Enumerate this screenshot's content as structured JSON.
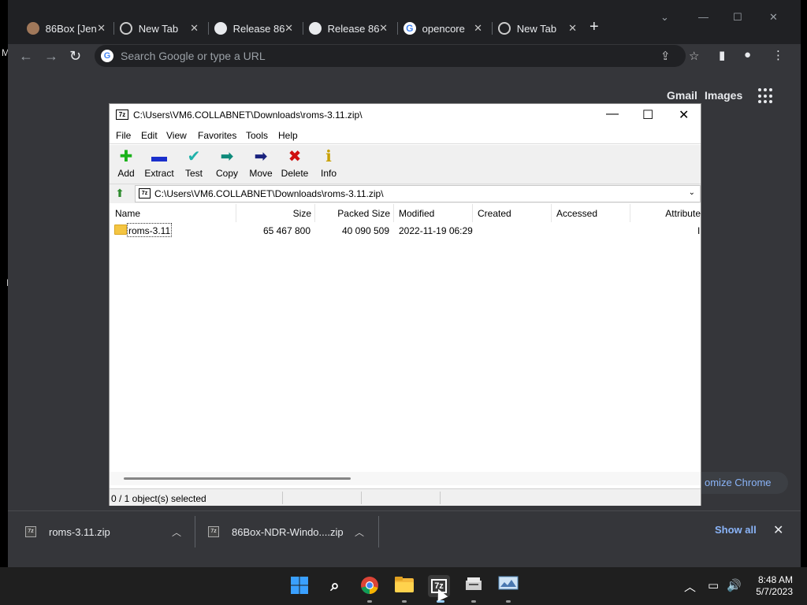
{
  "browser": {
    "tabs": [
      {
        "title": "86Box [Jen",
        "icon": "avatar-icon"
      },
      {
        "title": "New Tab",
        "icon": "chrome-icon"
      },
      {
        "title": "Release 86",
        "icon": "github-icon"
      },
      {
        "title": "Release 86",
        "icon": "github-icon"
      },
      {
        "title": "opencore",
        "icon": "google-icon"
      },
      {
        "title": "New Tab",
        "icon": "chrome-icon"
      }
    ],
    "omnibox_placeholder": "Search Google or type a URL",
    "ntp": {
      "gmail": "Gmail",
      "images": "Images",
      "customize": "omize Chrome"
    }
  },
  "sevenzip": {
    "title_path": "C:\\Users\\VM6.COLLABNET\\Downloads\\roms-3.11.zip\\",
    "menu": [
      "File",
      "Edit",
      "View",
      "Favorites",
      "Tools",
      "Help"
    ],
    "toolbar": [
      "Add",
      "Extract",
      "Test",
      "Copy",
      "Move",
      "Delete",
      "Info"
    ],
    "address": "C:\\Users\\VM6.COLLABNET\\Downloads\\roms-3.11.zip\\",
    "columns": [
      "Name",
      "Size",
      "Packed Size",
      "Modified",
      "Created",
      "Accessed",
      "Attribute"
    ],
    "rows": [
      {
        "name": "roms-3.11",
        "size": "65 467 800",
        "packed": "40 090 509",
        "modified": "2022-11-19 06:29",
        "created": "",
        "accessed": "",
        "attr": "I"
      }
    ],
    "status": "0 / 1 object(s) selected"
  },
  "downloads": {
    "items": [
      "roms-3.11.zip",
      "86Box-NDR-Windo....zip"
    ],
    "show_all": "Show all"
  },
  "taskbar": {
    "time": "8:48 AM",
    "date": "5/7/2023"
  },
  "colors": {
    "chrome_bg": "#35363a",
    "tabstrip": "#202124",
    "link": "#8ab4f8",
    "taskbar": "#1f1f1f"
  }
}
